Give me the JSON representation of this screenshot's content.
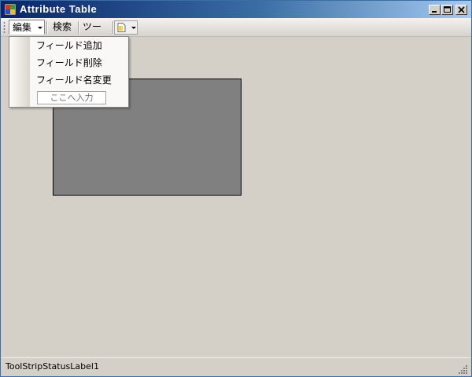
{
  "window": {
    "title": "Attribute Table",
    "accent_color": "#0a246a",
    "controls": [
      "minimize-icon",
      "maximize-icon",
      "close-icon"
    ]
  },
  "menu": {
    "edit_label": "編集",
    "search_label": "検索",
    "tools_label": "ツール",
    "tool_button_icon": "document-icon"
  },
  "dropdown": {
    "items": [
      "フィールド追加",
      "フィールド削除",
      "フィールド名変更"
    ],
    "input_placeholder": "ここへ入力"
  },
  "status": {
    "label": "ToolStripStatusLabel1"
  },
  "colors": {
    "panel": "#808080",
    "background": "#d4d0c8"
  }
}
